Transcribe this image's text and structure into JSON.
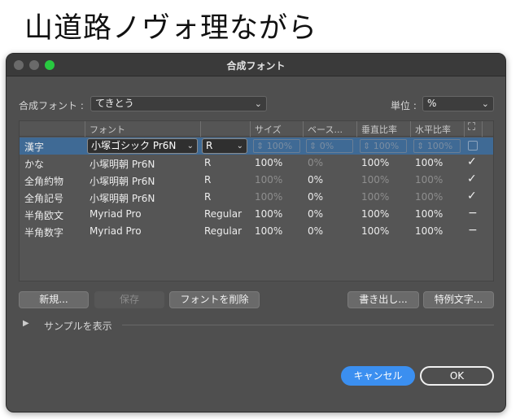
{
  "background_caption": "山道路ノヴォ理ながら",
  "window": {
    "title": "合成フォント"
  },
  "top": {
    "font_label": "合成フォント :",
    "font_value": "てきとう",
    "unit_label": "単位 :",
    "unit_value": "%"
  },
  "columns": [
    "フォント",
    "サイズ",
    "ベース...",
    "垂直比率",
    "水平比率"
  ],
  "rows": [
    {
      "name": "漢字",
      "font": "小塚ゴシック Pr6N",
      "style": "R",
      "size": "100%",
      "base": "0%",
      "vert": "100%",
      "horiz": "100%",
      "selected": true
    },
    {
      "name": "かな",
      "font": "小塚明朝 Pr6N",
      "style": "R",
      "size": "100%",
      "base": "0%",
      "vert": "100%",
      "horiz": "100%",
      "mark": "✓"
    },
    {
      "name": "全角約物",
      "font": "小塚明朝 Pr6N",
      "style": "R",
      "size": "100%",
      "base": "0%",
      "vert": "100%",
      "horiz": "100%",
      "mark": "✓"
    },
    {
      "name": "全角記号",
      "font": "小塚明朝 Pr6N",
      "style": "R",
      "size": "100%",
      "base": "0%",
      "vert": "100%",
      "horiz": "100%",
      "mark": "✓"
    },
    {
      "name": "半角欧文",
      "font": "Myriad Pro",
      "style": "Regular",
      "size": "100%",
      "base": "0%",
      "vert": "100%",
      "horiz": "100%",
      "mark": "−"
    },
    {
      "name": "半角数字",
      "font": "Myriad Pro",
      "style": "Regular",
      "size": "100%",
      "base": "0%",
      "vert": "100%",
      "horiz": "100%",
      "mark": "−"
    }
  ],
  "buttons": {
    "new": "新規...",
    "save": "保存",
    "delete": "フォントを削除",
    "export": "書き出し...",
    "special": "特例文字...",
    "cancel": "キャンセル",
    "ok": "OK"
  },
  "sample_label": "サンプルを表示",
  "icons": {
    "scale_all": "expand-arrows-icon",
    "disclosure": "triangle-right-icon"
  }
}
